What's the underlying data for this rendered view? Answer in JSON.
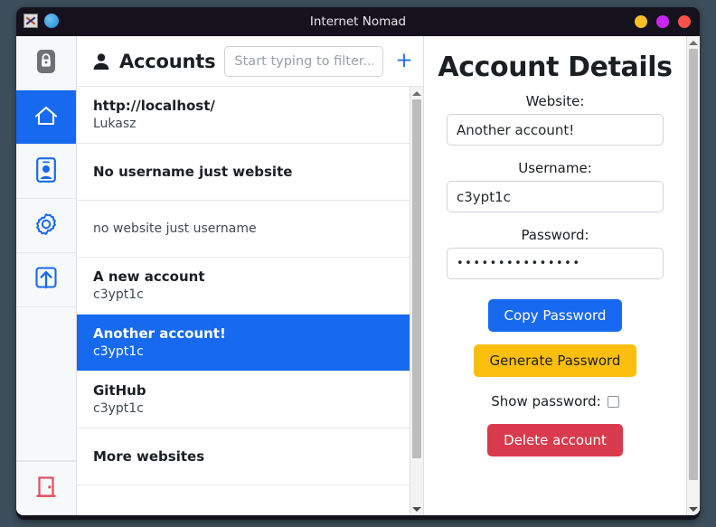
{
  "window": {
    "title": "Internet Nomad",
    "app_icon": "broken-image-icon",
    "status_icon": "blue-circle-icon",
    "buttons": {
      "minimize": "minimize-button",
      "maximize": "maximize-button",
      "close": "close-button"
    },
    "colors": {
      "titlebar_bg": "#15121d",
      "minimize": "#f7c028",
      "maximize": "#c925f2",
      "close": "#f9514a",
      "desktop_bg": "#3d4f5c"
    }
  },
  "sidebar": {
    "items": [
      {
        "icon": "lock-icon",
        "name": "app-logo",
        "active": false
      },
      {
        "icon": "home-icon",
        "name": "home",
        "active": true
      },
      {
        "icon": "contact-card-icon",
        "name": "contacts",
        "active": false
      },
      {
        "icon": "gear-icon",
        "name": "settings",
        "active": false
      },
      {
        "icon": "upload-icon",
        "name": "export",
        "active": false
      }
    ],
    "bottom_item": {
      "icon": "door-exit-icon",
      "name": "exit"
    },
    "colors": {
      "active_bg": "#1769f0",
      "panel_bg": "#f7f8fa"
    }
  },
  "list_panel": {
    "header": {
      "icon": "person-icon",
      "title": "Accounts",
      "filter_placeholder": "Start typing to filter...",
      "filter_value": "",
      "add_label": "+"
    },
    "accounts": [
      {
        "website": "http://localhost/",
        "username": "Lukasz",
        "selected": false
      },
      {
        "website": "No username just website",
        "username": "",
        "selected": false
      },
      {
        "website": "",
        "username": "no website just username",
        "selected": false
      },
      {
        "website": "A new account",
        "username": "c3ypt1c",
        "selected": false
      },
      {
        "website": "Another account!",
        "username": "c3ypt1c",
        "selected": true
      },
      {
        "website": "GitHub",
        "username": "c3ypt1c",
        "selected": false
      },
      {
        "website": "More websites",
        "username": "",
        "selected": false
      }
    ],
    "scrollbar": {
      "up_arrow": "scroll-up-arrow",
      "down_arrow": "scroll-down-arrow"
    }
  },
  "details_panel": {
    "title": "Account Details",
    "website_label": "Website:",
    "website_value": "Another account!",
    "username_label": "Username:",
    "username_value": "c3ypt1c",
    "password_label": "Password:",
    "password_value": "•••••••••••••••",
    "copy_button": "Copy Password",
    "generate_button": "Generate Password",
    "show_password_label": "Show password:",
    "show_password_checked": false,
    "delete_button": "Delete account",
    "colors": {
      "copy": "#1769f0",
      "generate": "#fcbf0d",
      "delete": "#d93a4d"
    },
    "scrollbar": {
      "up_arrow": "scroll-up-arrow",
      "down_arrow": "scroll-down-arrow"
    }
  }
}
